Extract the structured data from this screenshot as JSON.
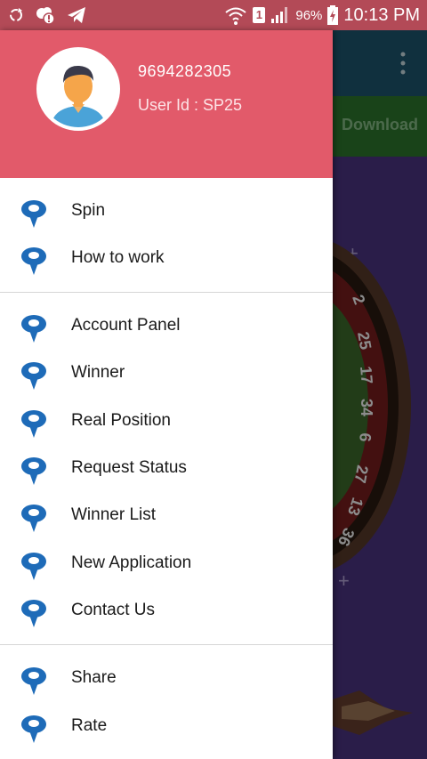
{
  "status_bar": {
    "sim_slot": "1",
    "battery": "96%",
    "time": "10:13 PM",
    "icons": [
      "sync-icon",
      "notification-icon",
      "telegram-icon",
      "wifi-icon",
      "signal-icon",
      "battery-charging-icon"
    ]
  },
  "drawer": {
    "header": {
      "phone": "9694282305",
      "user_id": "User Id : SP25",
      "avatar_icon": "user-avatar-icon",
      "header_color": "#e25a6a"
    },
    "groups": [
      [
        {
          "label": "Spin",
          "icon": "map-pin-icon"
        },
        {
          "label": "How to work",
          "icon": "map-pin-icon"
        }
      ],
      [
        {
          "label": "Account Panel",
          "icon": "map-pin-icon"
        },
        {
          "label": "Winner",
          "icon": "map-pin-icon"
        },
        {
          "label": "Real Position",
          "icon": "map-pin-icon"
        },
        {
          "label": "Request Status",
          "icon": "map-pin-icon"
        },
        {
          "label": "Winner List",
          "icon": "map-pin-icon"
        },
        {
          "label": "New Application",
          "icon": "map-pin-icon"
        },
        {
          "label": "Contact Us",
          "icon": "map-pin-icon"
        }
      ],
      [
        {
          "label": "Share",
          "icon": "map-pin-icon"
        },
        {
          "label": "Rate",
          "icon": "map-pin-icon"
        }
      ]
    ]
  },
  "background_app": {
    "download_label": "Download",
    "toolbar_color": "#1e5872",
    "wheel_numbers": [
      "2",
      "25",
      "17",
      "34",
      "6",
      "27",
      "13",
      "36"
    ]
  }
}
